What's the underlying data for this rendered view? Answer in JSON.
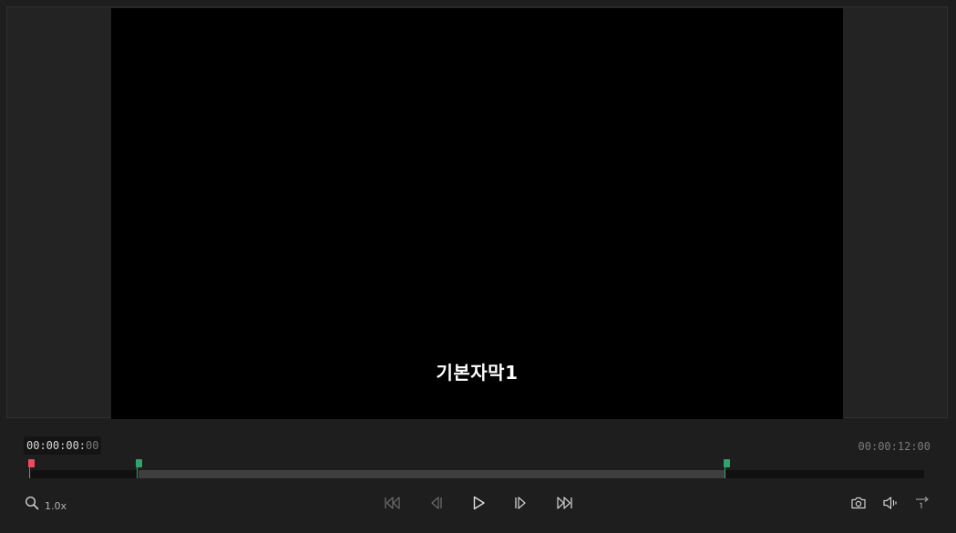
{
  "viewer": {
    "subtitle_text": "기본자막1"
  },
  "timecode": {
    "current_main": "00:00:00:",
    "current_frames": "00",
    "total": "00:00:12:00"
  },
  "timeline": {
    "playhead_fraction": 0.0,
    "in_fraction": 0.12,
    "out_fraction": 0.777
  },
  "zoom": {
    "label": "1.0x",
    "icon": "magnifier-icon"
  },
  "transport": {
    "icons": [
      "skip-to-start-icon",
      "step-back-icon",
      "play-icon",
      "step-forward-icon",
      "skip-to-end-icon"
    ]
  },
  "tools": {
    "icons": [
      "camera-icon",
      "volume-icon",
      "subtitle-track-icon"
    ]
  },
  "colors": {
    "playhead": "#f04a5e",
    "in_out_marker": "#2fa36b",
    "canvas": "#000000",
    "panel": "#1e1e1e"
  }
}
